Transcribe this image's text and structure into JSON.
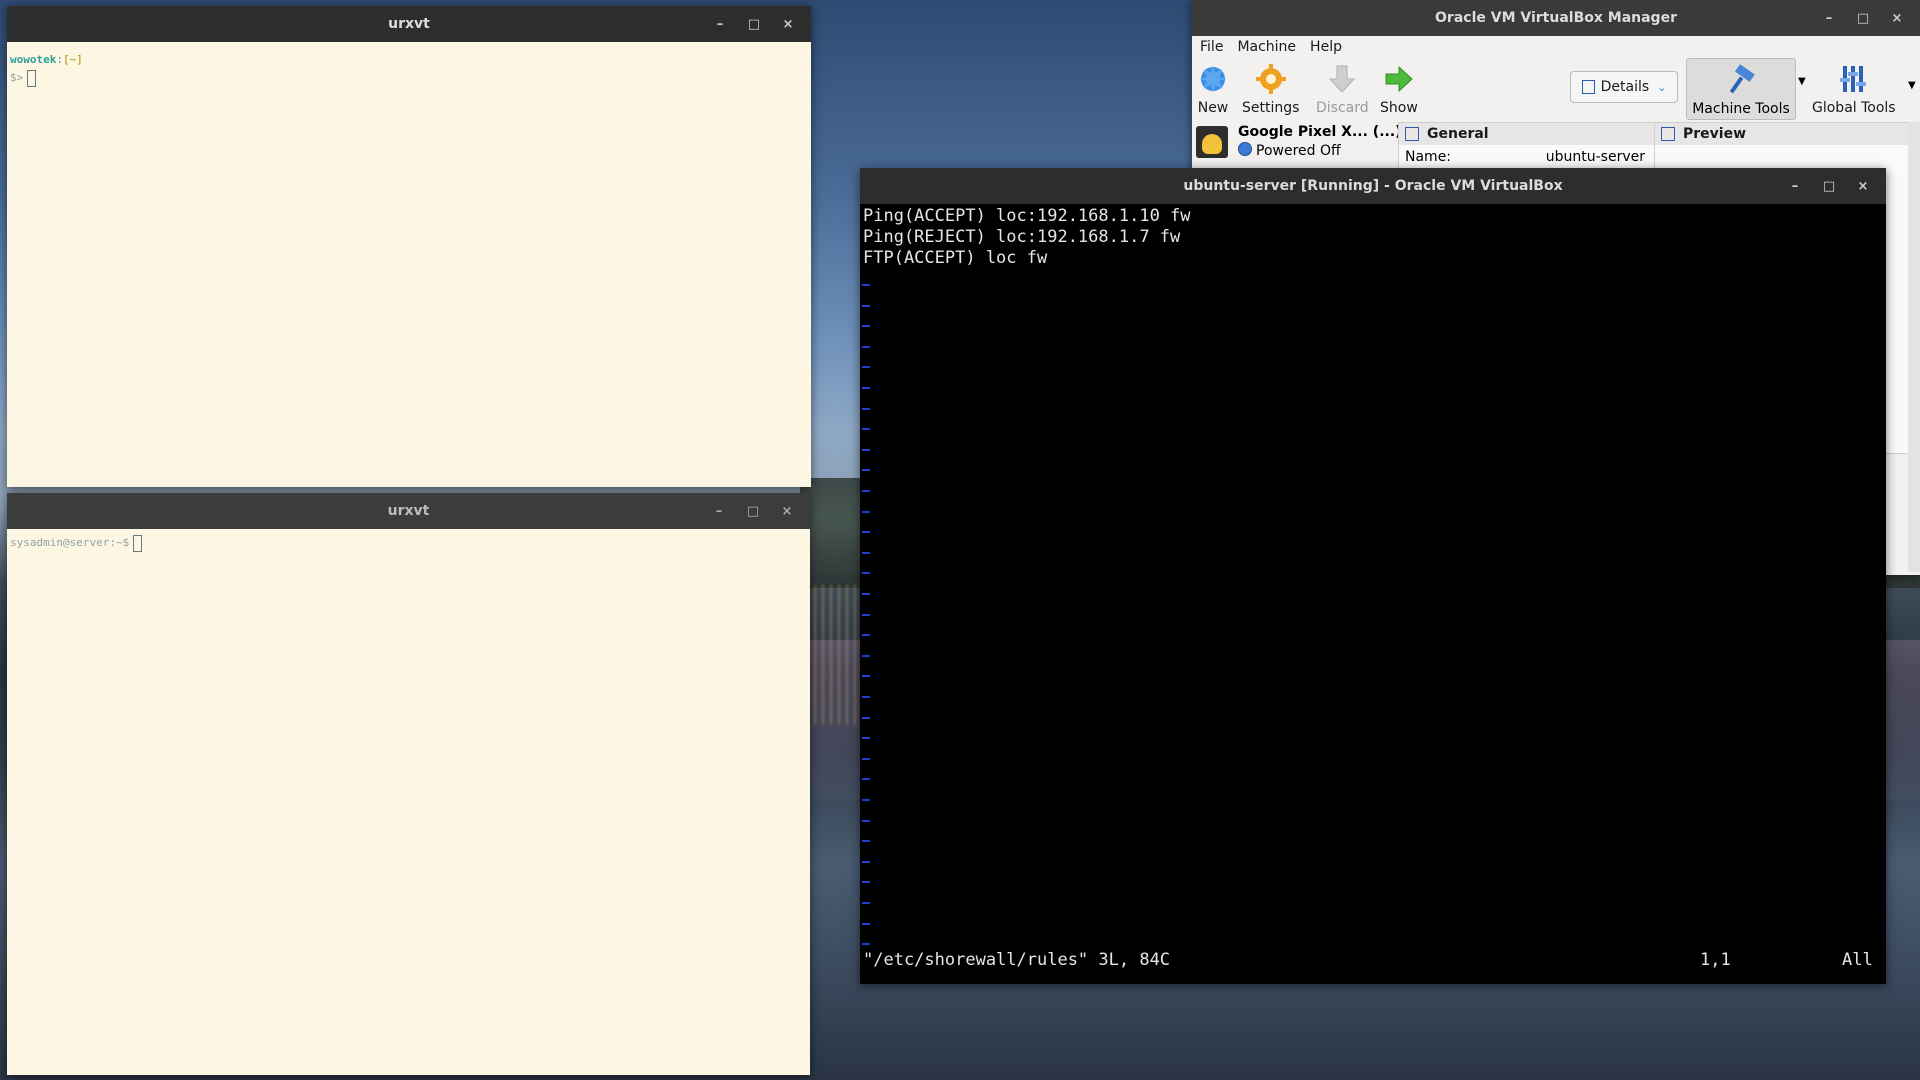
{
  "colors": {
    "term_bg": "#fdf6e3",
    "prompt_user": "#2aa198",
    "prompt_path": "#b58900",
    "tilde_blue": "#1f3fd1",
    "vm_text": "#e6e6e6"
  },
  "terminal_top": {
    "title": "urxvt",
    "prompt_user": "wowotek",
    "prompt_sep": ":",
    "prompt_path": "[~]",
    "prompt_symbol": "$>"
  },
  "terminal_bottom": {
    "title": "urxvt",
    "prompt": "sysadmin@server:~$"
  },
  "vbox_manager": {
    "title": "Oracle VM VirtualBox Manager",
    "menu": [
      "File",
      "Machine",
      "Help"
    ],
    "toolbar": {
      "new": "New",
      "settings": "Settings",
      "discard": "Discard",
      "show": "Show",
      "details": "Details",
      "machine_tools": "Machine Tools",
      "global_tools": "Global Tools"
    },
    "vm_item": {
      "name": "Google Pixel X... (...)",
      "state": "Powered Off"
    },
    "general_header": "General",
    "preview_header": "Preview",
    "name_label": "Name:",
    "name_value": "ubuntu-server"
  },
  "vm_window": {
    "title": "ubuntu-server [Running] - Oracle VM VirtualBox",
    "lines": [
      "Ping(ACCEPT) loc:192.168.1.10 fw",
      "Ping(REJECT) loc:192.168.1.7 fw",
      "FTP(ACCEPT) loc fw"
    ],
    "status_file": "\"/etc/shorewall/rules\" 3L, 84C",
    "status_pos": "1,1",
    "status_scroll": "All"
  },
  "window_controls": {
    "minimize": "–",
    "maximize": "□",
    "close": "×"
  }
}
